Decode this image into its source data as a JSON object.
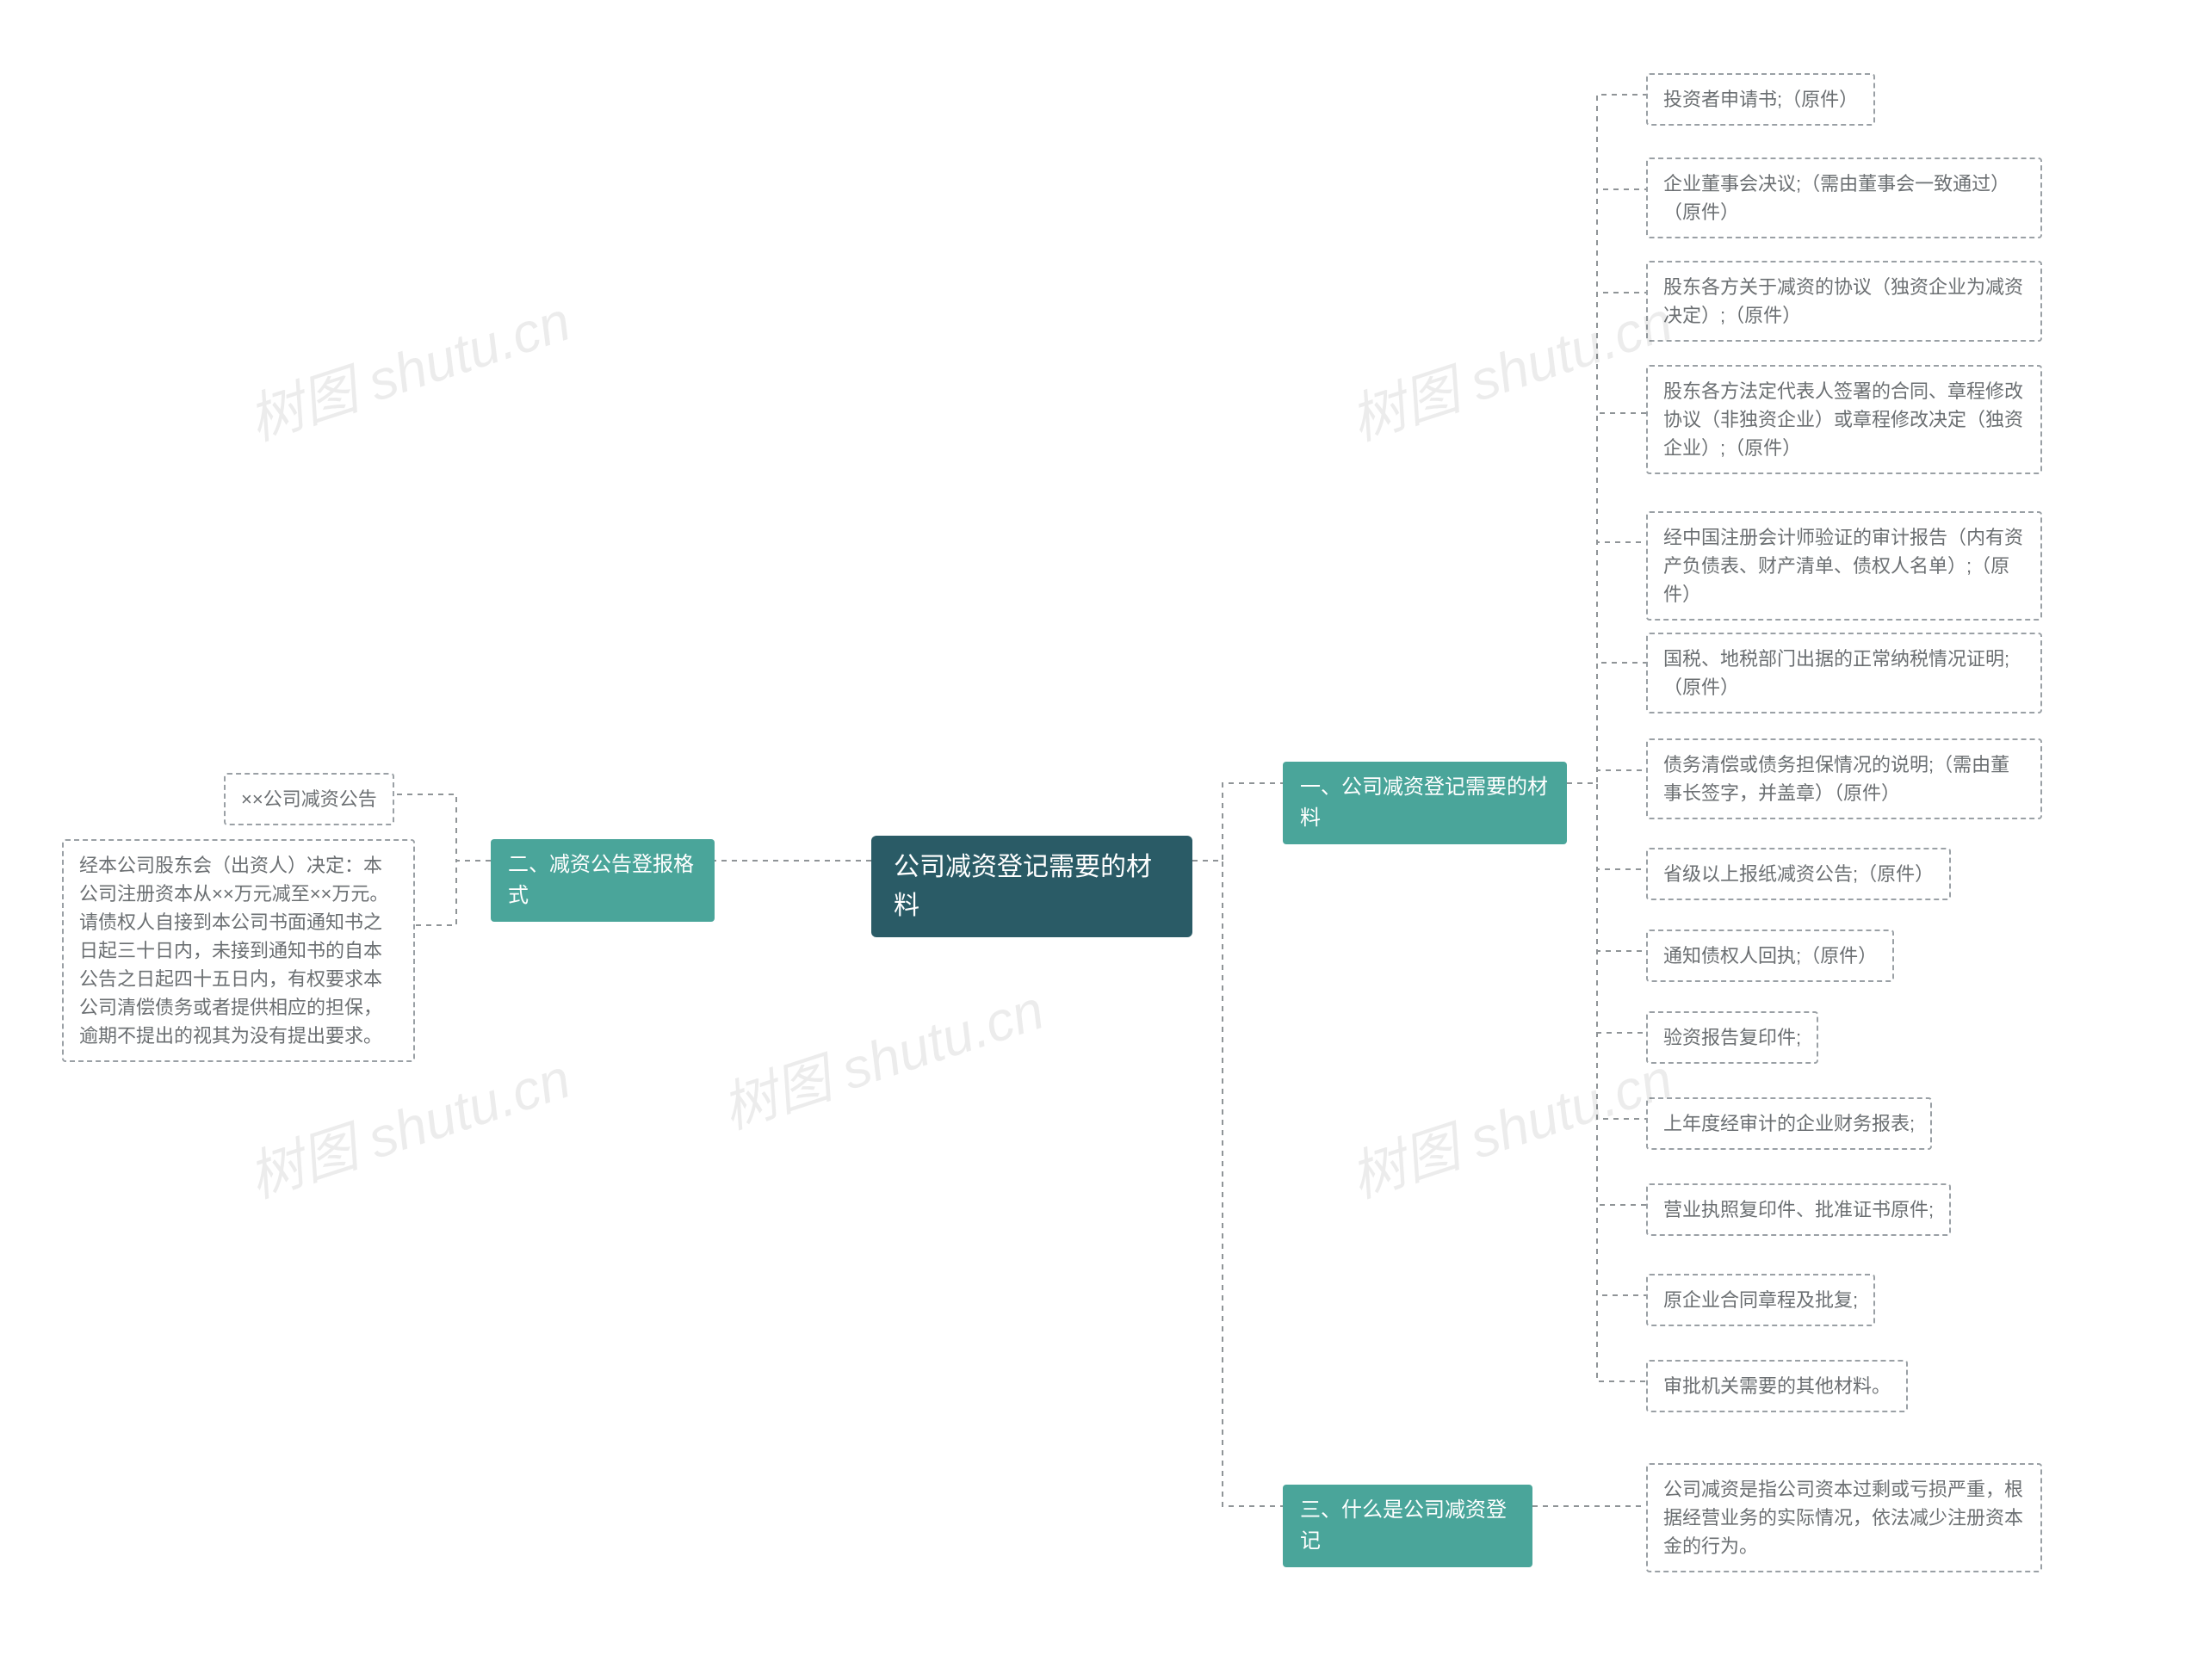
{
  "root": {
    "title": "公司减资登记需要的材料"
  },
  "branch1": {
    "title": "一、公司减资登记需要的材料",
    "items": [
      "投资者申请书;（原件）",
      "企业董事会决议;（需由董事会一致通过）（原件）",
      "股东各方关于减资的协议（独资企业为减资决定）;（原件）",
      "股东各方法定代表人签署的合同、章程修改协议（非独资企业）或章程修改决定（独资企业）;（原件）",
      "经中国注册会计师验证的审计报告（内有资产负债表、财产清单、债权人名单）;（原件）",
      "国税、地税部门出据的正常纳税情况证明;（原件）",
      "债务清偿或债务担保情况的说明;（需由董事长签字，并盖章）（原件）",
      "省级以上报纸减资公告;（原件）",
      "通知债权人回执;（原件）",
      "验资报告复印件;",
      "上年度经审计的企业财务报表;",
      "营业执照复印件、批准证书原件;",
      "原企业合同章程及批复;",
      "审批机关需要的其他材料。"
    ]
  },
  "branch2": {
    "title": "二、减资公告登报格式",
    "items": [
      "××公司减资公告",
      "经本公司股东会（出资人）决定：本公司注册资本从××万元减至××万元。请债权人自接到本公司书面通知书之日起三十日内，未接到通知书的自本公告之日起四十五日内，有权要求本公司清偿债务或者提供相应的担保，逾期不提出的视其为没有提出要求。"
    ]
  },
  "branch3": {
    "title": "三、什么是公司减资登记",
    "items": [
      "公司减资是指公司资本过剩或亏损严重，根据经营业务的实际情况，依法减少注册资本金的行为。"
    ]
  },
  "watermark": "树图 shutu.cn"
}
